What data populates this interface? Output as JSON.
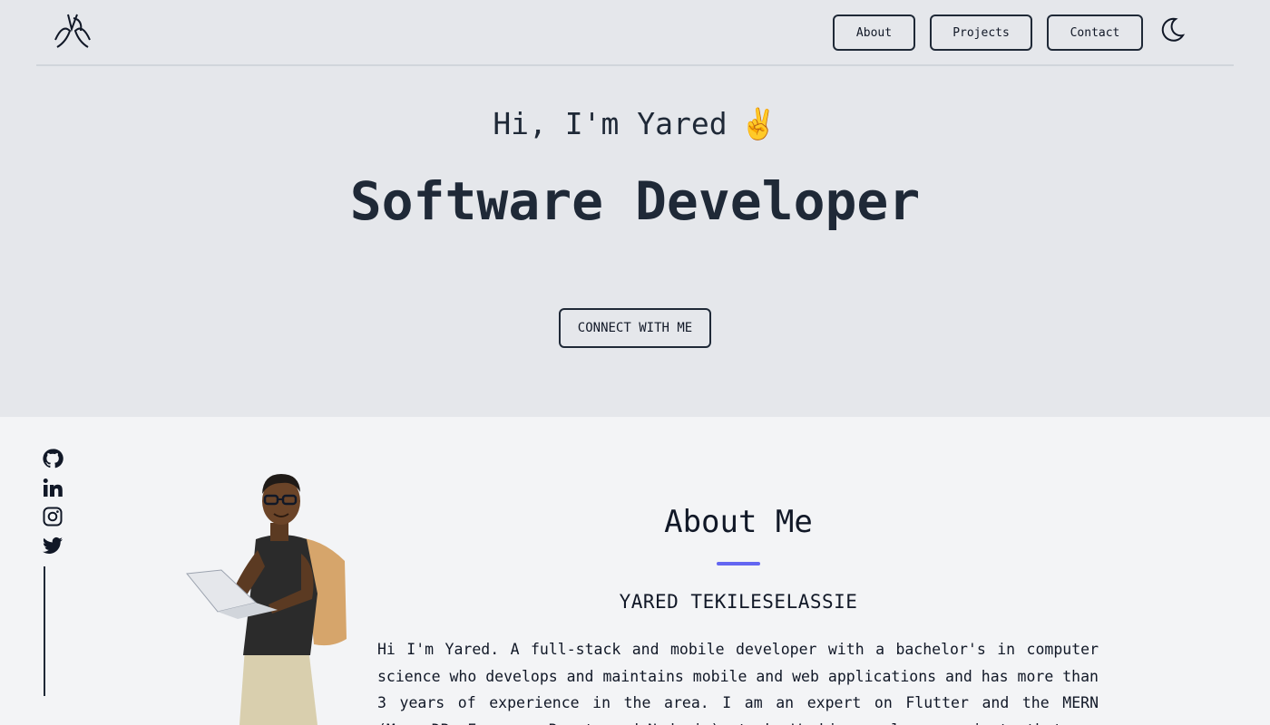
{
  "nav": {
    "logo": "logo-icon",
    "items": [
      {
        "label": "About"
      },
      {
        "label": "Projects"
      },
      {
        "label": "Contact"
      }
    ],
    "theme_icon": "moon-icon"
  },
  "hero": {
    "greeting": "Hi, I'm Yared",
    "greeting_emoji": "✌️",
    "title": "Software Developer",
    "cta_label": "CONNECT WITH ME"
  },
  "social": [
    "github-icon",
    "linkedin-icon",
    "instagram-icon",
    "twitter-icon"
  ],
  "about": {
    "title": "About Me",
    "name": "YARED TEKILESELASSIE",
    "bio": "Hi I'm Yared. A full-stack and mobile developer with a bachelor's in computer science who develops and maintains mobile and web applications and has more than 3 years of experience in the area. I am an expert on Flutter and the MERN (MongoDB, Express, React, and Node.js) stack. Working on large projects that"
  },
  "colors": {
    "accent": "#6366f1",
    "hero_bg": "#e5e7eb",
    "page_bg": "#f3f4f6",
    "text": "#1f2937"
  }
}
